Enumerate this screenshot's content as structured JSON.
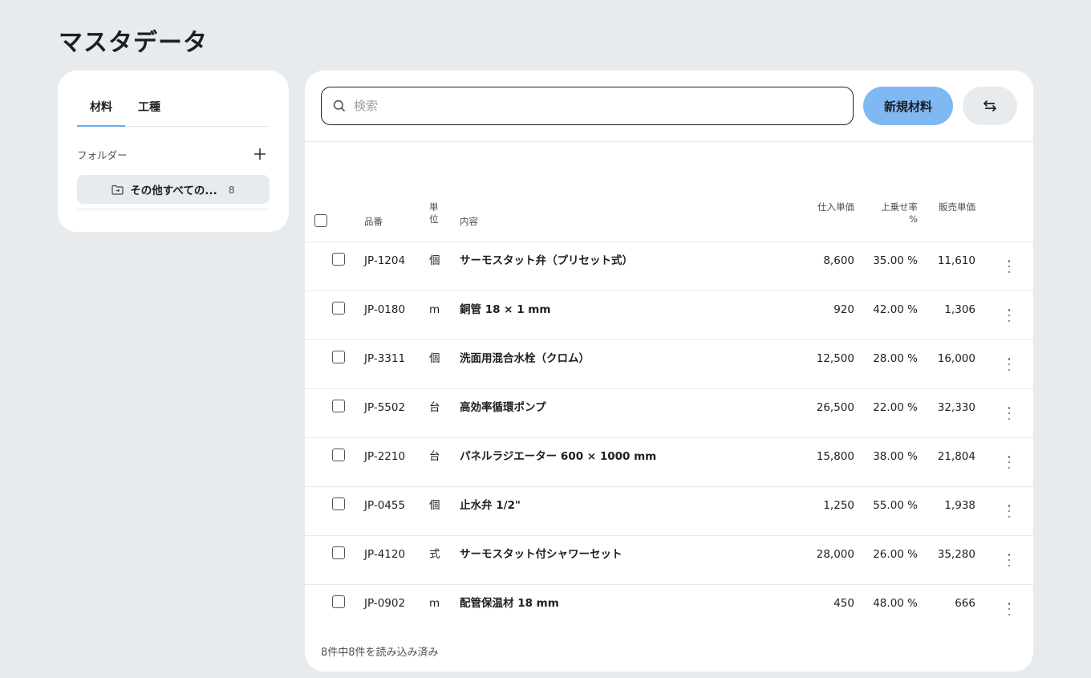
{
  "page": {
    "title": "マスタデータ"
  },
  "sidebar": {
    "tabs": [
      {
        "label": "材料",
        "active": true
      },
      {
        "label": "工種",
        "active": false
      }
    ],
    "folder_label": "フォルダー",
    "folder_item": {
      "name": "その他すべての...",
      "count": "8"
    }
  },
  "toolbar": {
    "search_placeholder": "検索",
    "new_button": "新規材料",
    "accent_color": "#7fb8f3"
  },
  "table": {
    "headers": {
      "code": "品番",
      "unit": "単位",
      "description": "内容",
      "cost": "仕入単価",
      "markup": "上乗せ率 %",
      "price": "販売単価"
    },
    "rows": [
      {
        "code": "JP-1204",
        "unit": "個",
        "description": "サーモスタット弁（プリセット式）",
        "cost": "8,600",
        "markup": "35.00 %",
        "price": "11,610"
      },
      {
        "code": "JP-0180",
        "unit": "m",
        "description": "銅管 18 × 1 mm",
        "cost": "920",
        "markup": "42.00 %",
        "price": "1,306"
      },
      {
        "code": "JP-3311",
        "unit": "個",
        "description": "洗面用混合水栓（クロム）",
        "cost": "12,500",
        "markup": "28.00 %",
        "price": "16,000"
      },
      {
        "code": "JP-5502",
        "unit": "台",
        "description": "高効率循環ポンプ",
        "cost": "26,500",
        "markup": "22.00 %",
        "price": "32,330"
      },
      {
        "code": "JP-2210",
        "unit": "台",
        "description": "パネルラジエーター 600 × 1000 mm",
        "cost": "15,800",
        "markup": "38.00 %",
        "price": "21,804"
      },
      {
        "code": "JP-0455",
        "unit": "個",
        "description": "止水弁 1/2\"",
        "cost": "1,250",
        "markup": "55.00 %",
        "price": "1,938"
      },
      {
        "code": "JP-4120",
        "unit": "式",
        "description": "サーモスタット付シャワーセット",
        "cost": "28,000",
        "markup": "26.00 %",
        "price": "35,280"
      },
      {
        "code": "JP-0902",
        "unit": "m",
        "description": "配管保温材 18 mm",
        "cost": "450",
        "markup": "48.00 %",
        "price": "666"
      }
    ],
    "footer": "8件中8件を読み込み済み"
  }
}
